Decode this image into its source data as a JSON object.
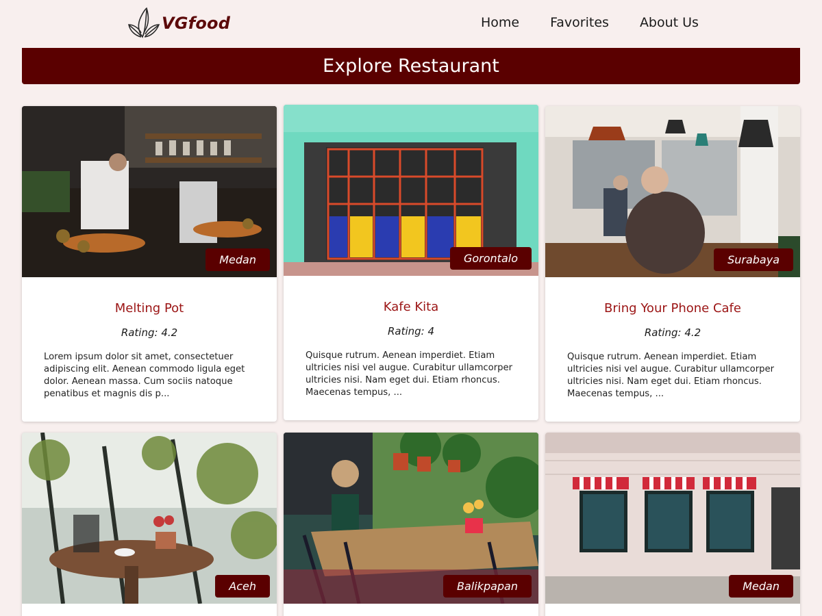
{
  "brand": {
    "name": "VGfood",
    "color": "#5c0a0a"
  },
  "nav": {
    "items": [
      "Home",
      "Favorites",
      "About Us"
    ]
  },
  "banner": {
    "title": "Explore Restaurant",
    "color": "#5a0000"
  },
  "restaurants": [
    {
      "name": "Melting Pot",
      "city": "Medan",
      "rating": "Rating: 4.2",
      "description": "Lorem ipsum dolor sit amet, consectetuer adipiscing elit. Aenean commodo ligula eget dolor. Aenean massa. Cum sociis natoque penatibus et magnis dis p...",
      "image": "kitchen-counter"
    },
    {
      "name": "Kafe Kita",
      "city": "Gorontalo",
      "rating": "Rating: 4",
      "description": "Quisque rutrum. Aenean imperdiet. Etiam ultricies nisi vel augue. Curabitur ullamcorper ultricies nisi. Nam eget dui. Etiam rhoncus. Maecenas tempus, ...",
      "image": "colorful-storefront"
    },
    {
      "name": "Bring Your Phone Cafe",
      "city": "Surabaya",
      "rating": "Rating: 4.2",
      "description": "Quisque rutrum. Aenean imperdiet. Etiam ultricies nisi vel augue. Curabitur ullamcorper ultricies nisi. Nam eget dui. Etiam rhoncus. Maecenas tempus, ...",
      "image": "cafe-interior"
    },
    {
      "name": "",
      "city": "Aceh",
      "rating": "",
      "description": "",
      "image": "greenhouse-table"
    },
    {
      "name": "",
      "city": "Balikpapan",
      "rating": "",
      "description": "",
      "image": "outdoor-terrace"
    },
    {
      "name": "",
      "city": "Medan",
      "rating": "",
      "description": "",
      "image": "street-shopfront"
    }
  ]
}
